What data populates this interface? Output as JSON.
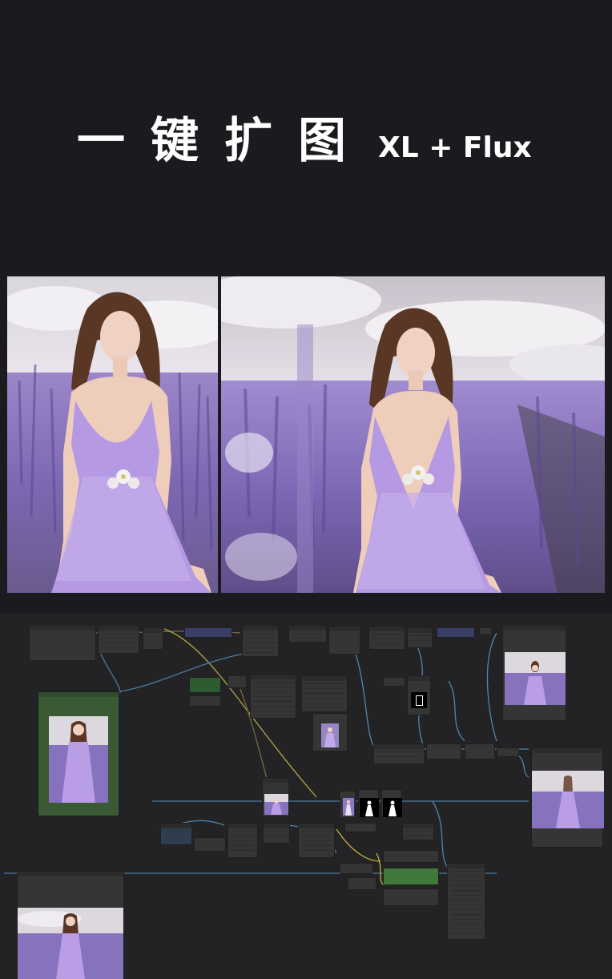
{
  "header": {
    "title_cn": "一键扩图",
    "title_en": "XL + Flux"
  },
  "colors": {
    "background": "#1b1a1e",
    "canvas": "#232325",
    "node": "#353535",
    "node_green": "#2f5b31",
    "node_blue": "#3a3f67",
    "lavender": "#8a70c4",
    "dress": "#b79ae6"
  },
  "comparison": {
    "left_label": "",
    "right_label": ""
  },
  "workflow": {
    "mask_icon": "mask-icon"
  }
}
